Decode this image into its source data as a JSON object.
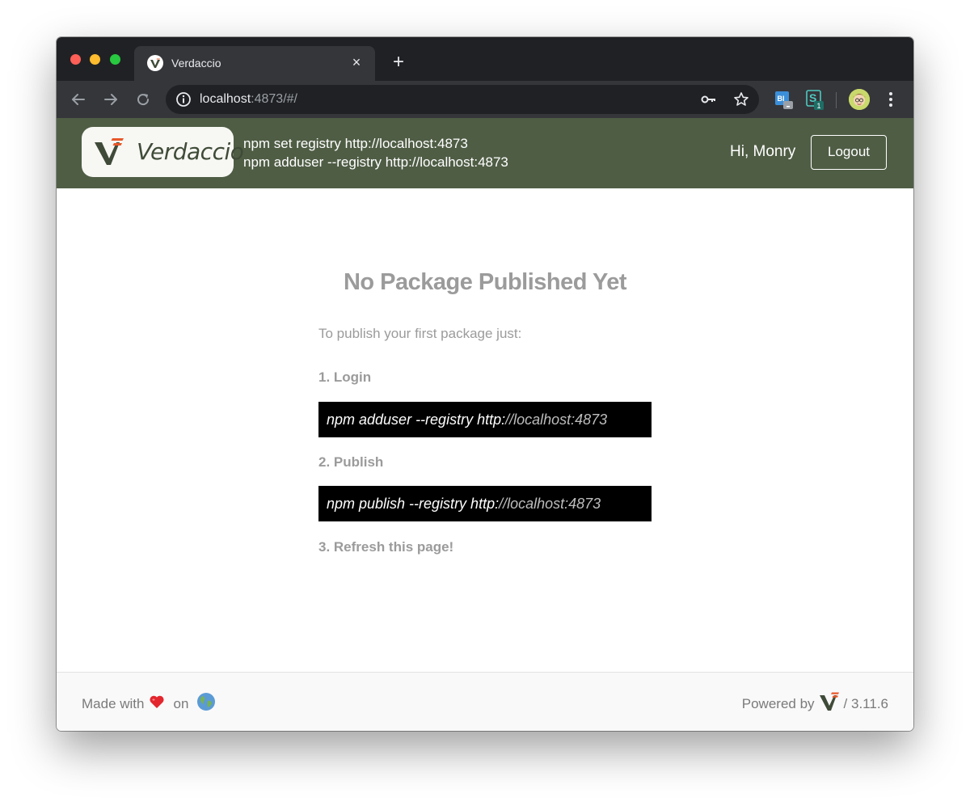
{
  "browser": {
    "tab": {
      "title": "Verdaccio",
      "close_glyph": "×",
      "favicon": "verdaccio-logo-icon"
    },
    "new_tab_glyph": "+",
    "address": {
      "host": "localhost",
      "rest": ":4873/#/"
    },
    "extensions": [
      {
        "name": "extension-bi-icon",
        "label": "BI",
        "badge": "..."
      },
      {
        "name": "extension-s-icon",
        "label": "S",
        "badge": "1"
      }
    ]
  },
  "header": {
    "logo_text": "Verdaccio",
    "registry_commands": [
      "npm set registry http://localhost:4873",
      "npm adduser --registry http://localhost:4873"
    ],
    "greeting": "Hi, Monry",
    "logout_label": "Logout",
    "background_color": "#4f5d45"
  },
  "help": {
    "title": "No Package Published Yet",
    "intro": "To publish your first package just:",
    "steps": [
      {
        "label": "1. Login",
        "command": "npm adduser --registry  http:",
        "command_tail": "//localhost:4873"
      },
      {
        "label": "2. Publish",
        "command": "npm publish --registry http:",
        "command_tail": "//localhost:4873"
      },
      {
        "label": "3. Refresh this page!"
      }
    ]
  },
  "footer": {
    "made_with": "Made with",
    "on": "on",
    "powered_by": "Powered by",
    "version": "/ 3.11.6"
  }
}
